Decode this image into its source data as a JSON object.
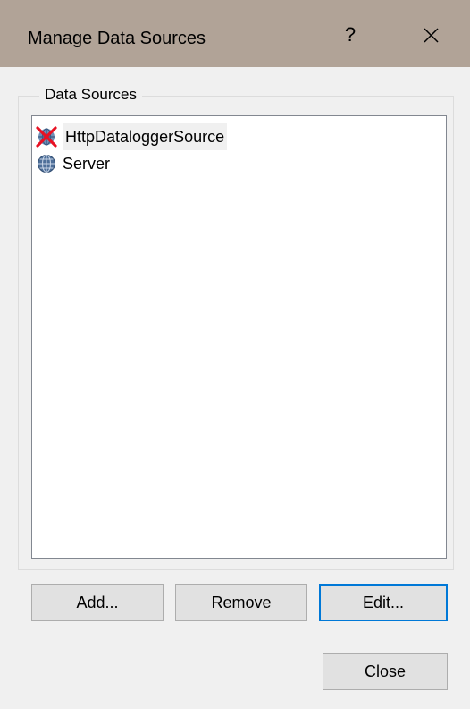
{
  "dialog": {
    "title": "Manage Data Sources",
    "help_label": "?",
    "close_icon": "close-icon"
  },
  "group": {
    "label": "Data Sources"
  },
  "sources": [
    {
      "label": "HttpDataloggerSource",
      "icon": "disconnected-globe-icon",
      "selected": true
    },
    {
      "label": "Server",
      "icon": "globe-icon",
      "selected": false
    }
  ],
  "buttons": {
    "add": "Add...",
    "remove": "Remove",
    "edit": "Edit...",
    "close": "Close"
  },
  "colors": {
    "titlebar": "#b1a397",
    "dialog_bg": "#f0f0f0",
    "default_button_border": "#0078d7",
    "error_cross": "#e81123"
  }
}
